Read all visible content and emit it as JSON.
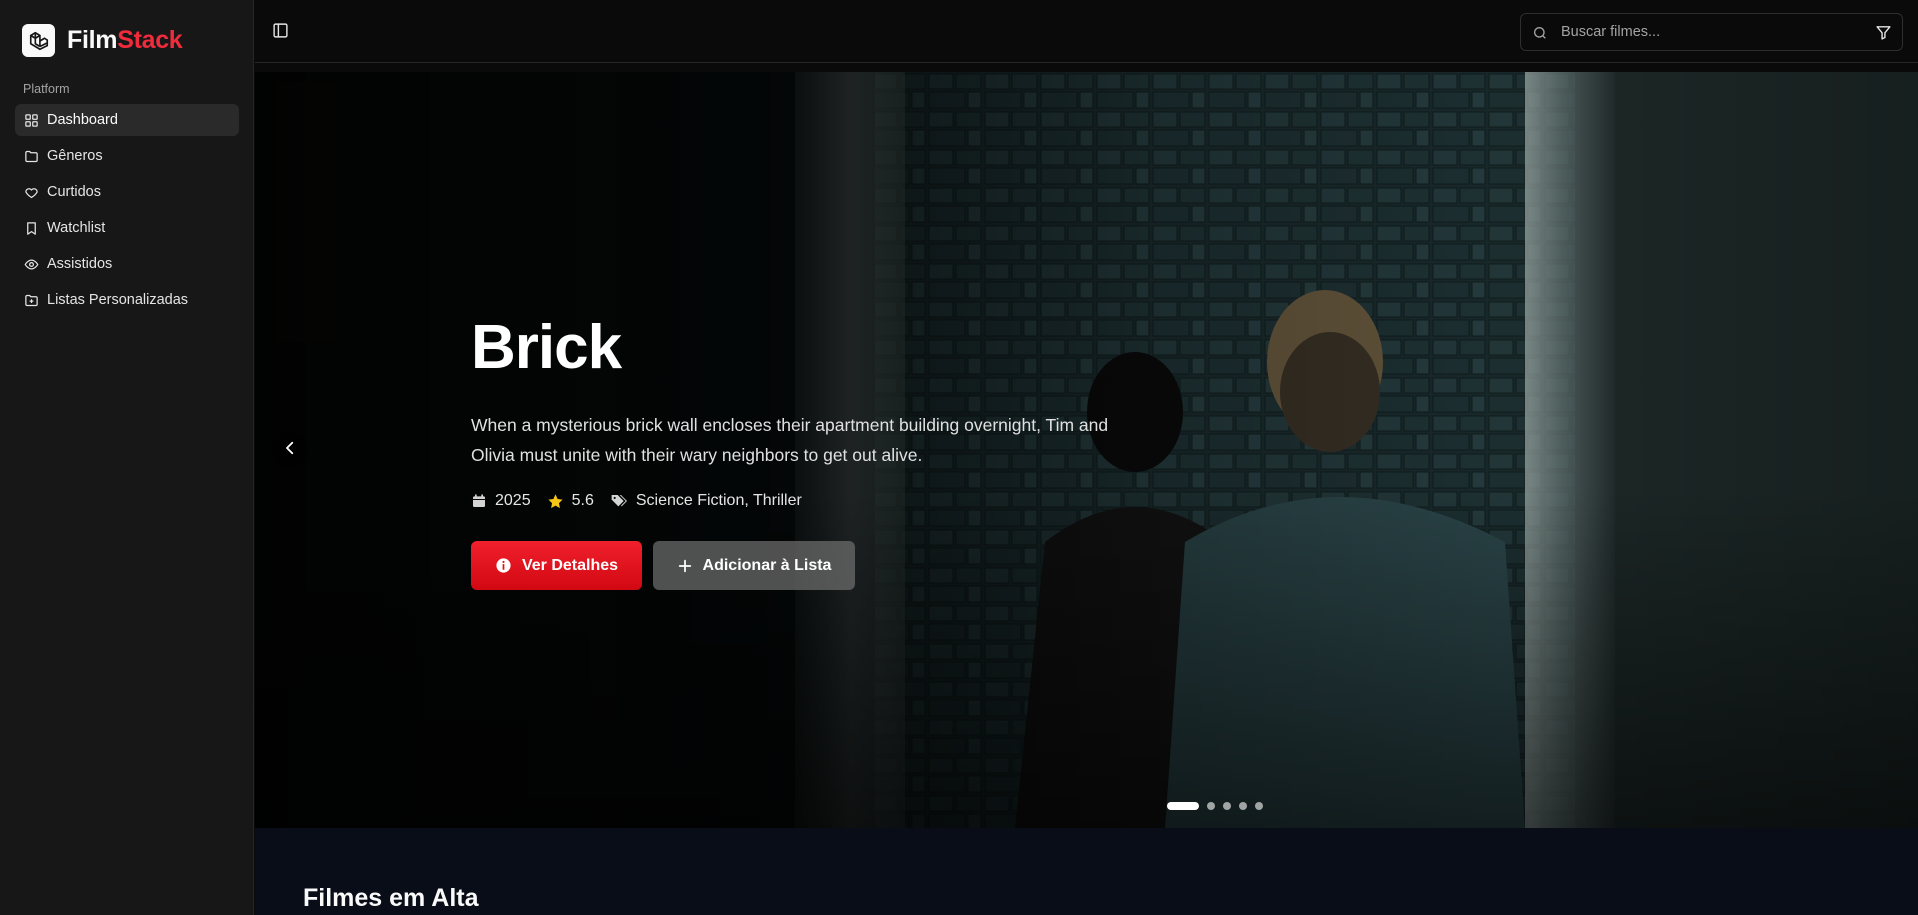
{
  "app": {
    "name_part1": "Film",
    "name_part2": "Stack",
    "brand_accent": "#ef2b3c"
  },
  "sidebar": {
    "section_label": "Platform",
    "items": [
      {
        "label": "Dashboard",
        "icon": "grid-icon",
        "active": true
      },
      {
        "label": "Gêneros",
        "icon": "folder-icon"
      },
      {
        "label": "Curtidos",
        "icon": "heart-icon"
      },
      {
        "label": "Watchlist",
        "icon": "bookmark-icon"
      },
      {
        "label": "Assistidos",
        "icon": "eye-icon"
      },
      {
        "label": "Listas Personalizadas",
        "icon": "folder-plus-icon"
      }
    ]
  },
  "search": {
    "placeholder": "Buscar filmes..."
  },
  "hero": {
    "title": "Brick",
    "description": "When a mysterious brick wall encloses their apartment building overnight, Tim and Olivia must unite with their wary neighbors to get out alive.",
    "year": "2025",
    "rating": "5.6",
    "genres": "Science Fiction, Thriller",
    "primary_button": "Ver Detalhes",
    "secondary_button": "Adicionar à Lista",
    "primary_color": "#e50914",
    "slide_count": 5,
    "active_slide": 1
  },
  "section": {
    "title": "Filmes em Alta"
  }
}
